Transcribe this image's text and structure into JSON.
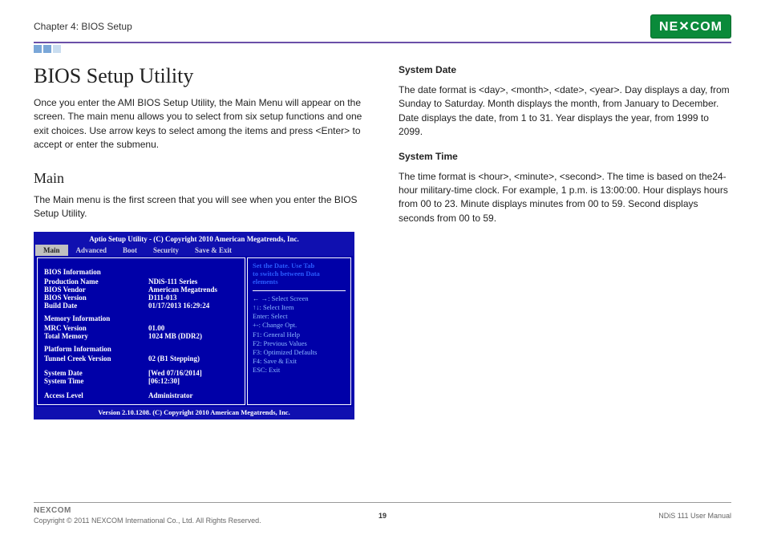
{
  "header": {
    "chapter": "Chapter 4: BIOS Setup",
    "logo_text": "NEXCOM"
  },
  "left": {
    "title": "BIOS Setup Utility",
    "intro": "Once you enter the AMI BIOS Setup Utility, the Main Menu will appear on the screen. The main menu allows you to select from six setup functions and one exit choices. Use arrow keys to select among the items and press <Enter> to accept or enter the submenu.",
    "main_h": "Main",
    "main_p": "The Main menu is the first screen that you will see when you enter the BIOS Setup Utility."
  },
  "right": {
    "sd_h": "System Date",
    "sd_p": "The date format is <day>, <month>, <date>, <year>. Day displays a day, from Sunday to Saturday. Month displays the month, from January to December. Date displays the date, from 1 to 31. Year displays the year, from 1999 to 2099.",
    "st_h": "System Time",
    "st_p": "The time format is <hour>, <minute>, <second>. The time is based on the24-hour military-time clock. For example, 1 p.m. is 13:00:00. Hour displays hours from 00 to 23. Minute displays minutes from 00 to 59. Second displays seconds from 00 to 59."
  },
  "bios": {
    "top": "Aptio Setup Utility - (C) Copyright 2010 American Megatrends, Inc.",
    "tabs": [
      "Main",
      "Advanced",
      "Boot",
      "Security",
      "Save & Exit"
    ],
    "info_h": "BIOS Information",
    "prod_l": "Production Name",
    "prod_v": "NDiS-111 Series",
    "vendor_l": "BIOS Vendor",
    "vendor_v": "American Megatrends",
    "ver_l": "BIOS Version",
    "ver_v": "D111-013",
    "build_l": "Build Date",
    "build_v": "01/17/2013  16:29:24",
    "mem_h": "Memory Information",
    "mrc_l": "MRC Version",
    "mrc_v": "01.00",
    "tmem_l": "Total Memory",
    "tmem_v": "1024 MB (DDR2)",
    "plat_h": "Platform Information",
    "tun_l": "Tunnel Creek Version",
    "tun_v": "02 (B1 Stepping)",
    "sdate_l": "System Date",
    "sdate_v": "[Wed 07/16/2014]",
    "stime_l": "System Time",
    "stime_v": "[06:12:30]",
    "acc_l": "Access Level",
    "acc_v": "Administrator",
    "hint1": "Set the Date. Use Tab",
    "hint2": "to switch between Data",
    "hint3": "elements",
    "nav": [
      "← →: Select Screen",
      "↑↓:   Select Item",
      "Enter: Select",
      "+-:   Change Opt.",
      "F1:   General Help",
      "F2:   Previous Values",
      "F3:   Optimized Defaults",
      "F4:   Save & Exit",
      "ESC: Exit"
    ],
    "bottom": "Version 2.10.1208. (C) Copyright 2010 American Megatrends, Inc."
  },
  "footer": {
    "logo": "NEXCOM",
    "copy": "Copyright © 2011 NEXCOM International Co., Ltd. All Rights Reserved.",
    "page": "19",
    "manual": "NDiS 111 User Manual"
  }
}
